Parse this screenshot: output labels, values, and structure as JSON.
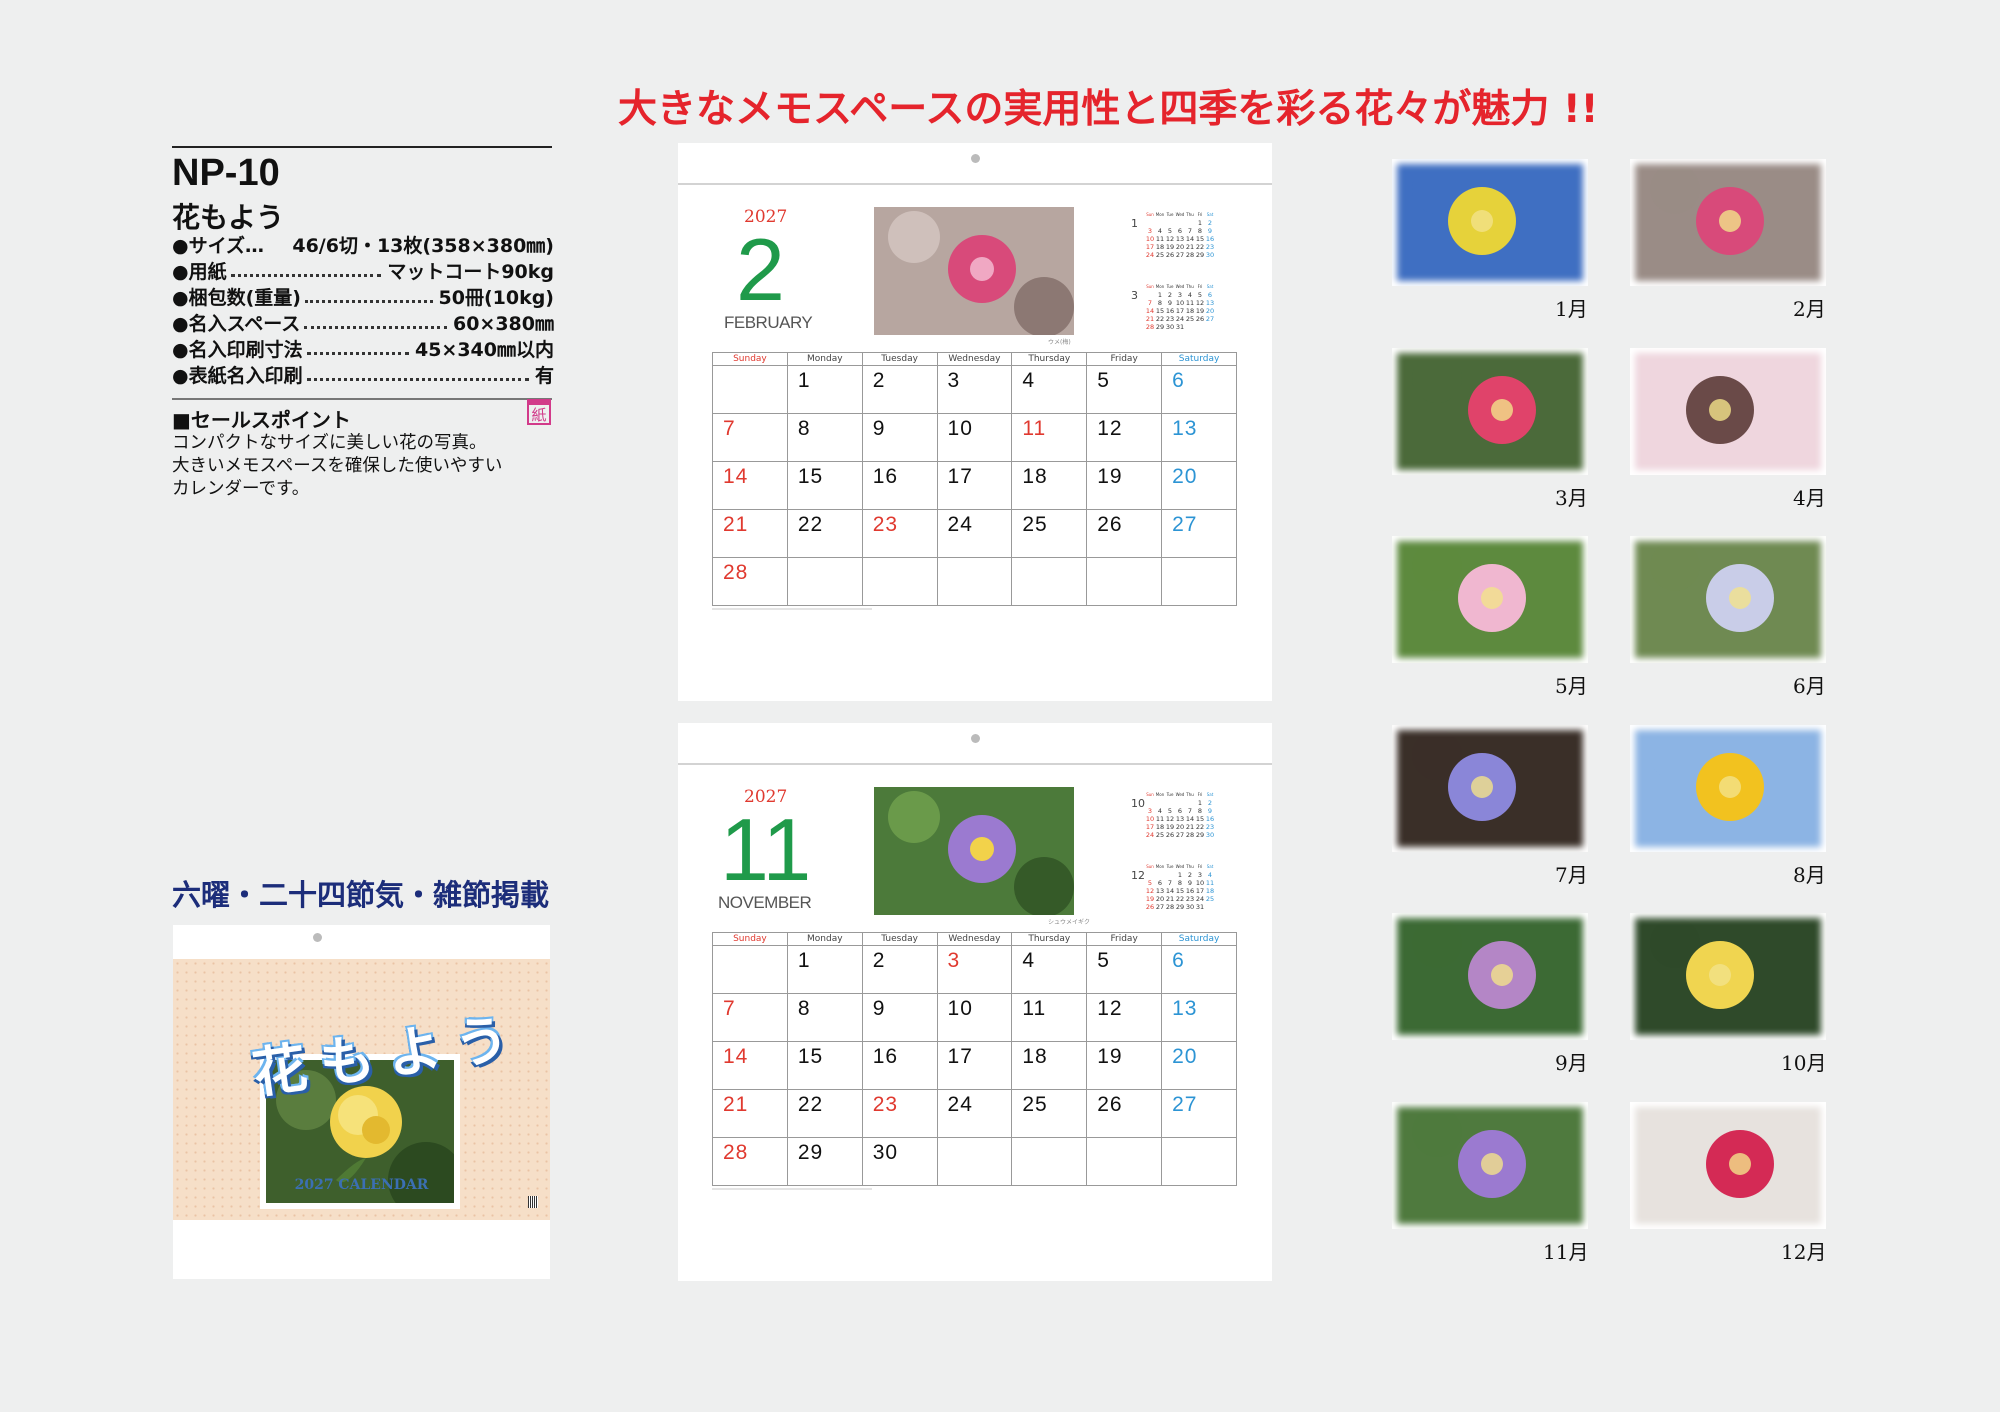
{
  "headline": "大きなメモスペースの実用性と四季を彩る花々が魅力 !!",
  "product": {
    "code": "NP-10",
    "name": "花もよう",
    "specs": [
      {
        "key": "●サイズ…",
        "value": "46/6切・13枚(358×380㎜)",
        "dotted": false
      },
      {
        "key": "●用紙",
        "value": "マットコート90kg",
        "dotted": true
      },
      {
        "key": "●梱包数(重量)",
        "value": "50冊(10kg)",
        "dotted": true
      },
      {
        "key": "●名入スペース",
        "value": "60×380㎜",
        "dotted": true
      },
      {
        "key": "●名入印刷寸法",
        "value": "45×340㎜以内",
        "dotted": true
      },
      {
        "key": "●表紙名入印刷",
        "value": "有",
        "dotted": true
      }
    ],
    "sales_point_title": "■セールスポイント",
    "sales_point_icon": "紙",
    "sales_point_lines": [
      "コンパクトなサイズに美しい花の写真。",
      "大きいメモスペースを確保した使いやすい",
      "カレンダーです。"
    ],
    "features": "六曜・二十四節気・雑節掲載"
  },
  "cover": {
    "title": "花もよう",
    "caption": "2027 CALENDAR"
  },
  "weekdays": [
    "Sunday",
    "Monday",
    "Tuesday",
    "Wednesday",
    "Thursday",
    "Friday",
    "Saturday"
  ],
  "calendars": [
    {
      "year": "2027",
      "month": "2",
      "month_name": "FEBRUARY",
      "photo_caption": "ウメ(梅)",
      "mini": [
        {
          "month": "1",
          "rows": [
            [
              "",
              "",
              "",
              "",
              "",
              "1",
              "2"
            ],
            [
              "3",
              "4",
              "5",
              "6",
              "7",
              "8",
              "9"
            ],
            [
              "10",
              "11",
              "12",
              "13",
              "14",
              "15",
              "16"
            ],
            [
              "17",
              "18",
              "19",
              "20",
              "21",
              "22",
              "23"
            ],
            [
              "24/31",
              "25",
              "26",
              "27",
              "28",
              "29",
              "30"
            ]
          ]
        },
        {
          "month": "3",
          "rows": [
            [
              "",
              "1",
              "2",
              "3",
              "4",
              "5",
              "6"
            ],
            [
              "7",
              "8",
              "9",
              "10",
              "11",
              "12",
              "13"
            ],
            [
              "14",
              "15",
              "16",
              "17",
              "18",
              "19",
              "20"
            ],
            [
              "21",
              "22",
              "23",
              "24",
              "25",
              "26",
              "27"
            ],
            [
              "28",
              "29",
              "30",
              "31",
              "",
              "",
              ""
            ]
          ]
        }
      ],
      "weeks": [
        [
          "",
          "1",
          "2",
          "3",
          "4",
          "5",
          "6"
        ],
        [
          "7",
          "8",
          "9",
          "10",
          "11",
          "12",
          "13"
        ],
        [
          "14",
          "15",
          "16",
          "17",
          "18",
          "19",
          "20"
        ],
        [
          "21",
          "22",
          "23",
          "24",
          "25",
          "26",
          "27"
        ],
        [
          "28",
          "",
          "",
          "",
          "",
          "",
          ""
        ]
      ],
      "holidays": [
        "11",
        "23"
      ]
    },
    {
      "year": "2027",
      "month": "11",
      "month_name": "NOVEMBER",
      "photo_caption": "シュウメイギク",
      "mini": [
        {
          "month": "10",
          "rows": [
            [
              "",
              "",
              "",
              "",
              "",
              "1",
              "2"
            ],
            [
              "3",
              "4",
              "5",
              "6",
              "7",
              "8",
              "9"
            ],
            [
              "10",
              "11",
              "12",
              "13",
              "14",
              "15",
              "16"
            ],
            [
              "17",
              "18",
              "19",
              "20",
              "21",
              "22",
              "23"
            ],
            [
              "24/31",
              "25",
              "26",
              "27",
              "28",
              "29",
              "30"
            ]
          ]
        },
        {
          "month": "12",
          "rows": [
            [
              "",
              "",
              "",
              "1",
              "2",
              "3",
              "4"
            ],
            [
              "5",
              "6",
              "7",
              "8",
              "9",
              "10",
              "11"
            ],
            [
              "12",
              "13",
              "14",
              "15",
              "16",
              "17",
              "18"
            ],
            [
              "19",
              "20",
              "21",
              "22",
              "23",
              "24",
              "25"
            ],
            [
              "26",
              "27",
              "28",
              "29",
              "30",
              "31",
              ""
            ]
          ]
        }
      ],
      "weeks": [
        [
          "",
          "1",
          "2",
          "3",
          "4",
          "5",
          "6"
        ],
        [
          "7",
          "8",
          "9",
          "10",
          "11",
          "12",
          "13"
        ],
        [
          "14",
          "15",
          "16",
          "17",
          "18",
          "19",
          "20"
        ],
        [
          "21",
          "22",
          "23",
          "24",
          "25",
          "26",
          "27"
        ],
        [
          "28",
          "29",
          "30",
          "",
          "",
          "",
          ""
        ]
      ],
      "holidays": [
        "3",
        "23"
      ]
    }
  ],
  "thumbnails": [
    {
      "label": "1月",
      "colors": [
        "#3f6fc2",
        "#e6d23a"
      ]
    },
    {
      "label": "2月",
      "colors": [
        "#9a8c86",
        "#d84a7a"
      ]
    },
    {
      "label": "3月",
      "colors": [
        "#4b6a3a",
        "#e0436a"
      ]
    },
    {
      "label": "4月",
      "colors": [
        "#efd6de",
        "#6a4a48"
      ]
    },
    {
      "label": "5月",
      "colors": [
        "#5d8a3e",
        "#f0b7d0"
      ]
    },
    {
      "label": "6月",
      "colors": [
        "#6f8a52",
        "#c9cde8"
      ]
    },
    {
      "label": "7月",
      "colors": [
        "#3a2f28",
        "#8a86d8"
      ]
    },
    {
      "label": "8月",
      "colors": [
        "#8cb4e4",
        "#f2c21f"
      ]
    },
    {
      "label": "9月",
      "colors": [
        "#3c6a34",
        "#b486c6"
      ]
    },
    {
      "label": "10月",
      "colors": [
        "#2f4a2a",
        "#f0d550"
      ]
    },
    {
      "label": "11月",
      "colors": [
        "#4f7a3e",
        "#9b7ad0"
      ]
    },
    {
      "label": "12月",
      "colors": [
        "#e7e2de",
        "#d42a55"
      ]
    }
  ],
  "colors": {
    "headline": "#e5242c",
    "green": "#1f9a4a",
    "sunday": "#e0392f",
    "saturday": "#2c94d4",
    "features": "#1c2d7a"
  }
}
